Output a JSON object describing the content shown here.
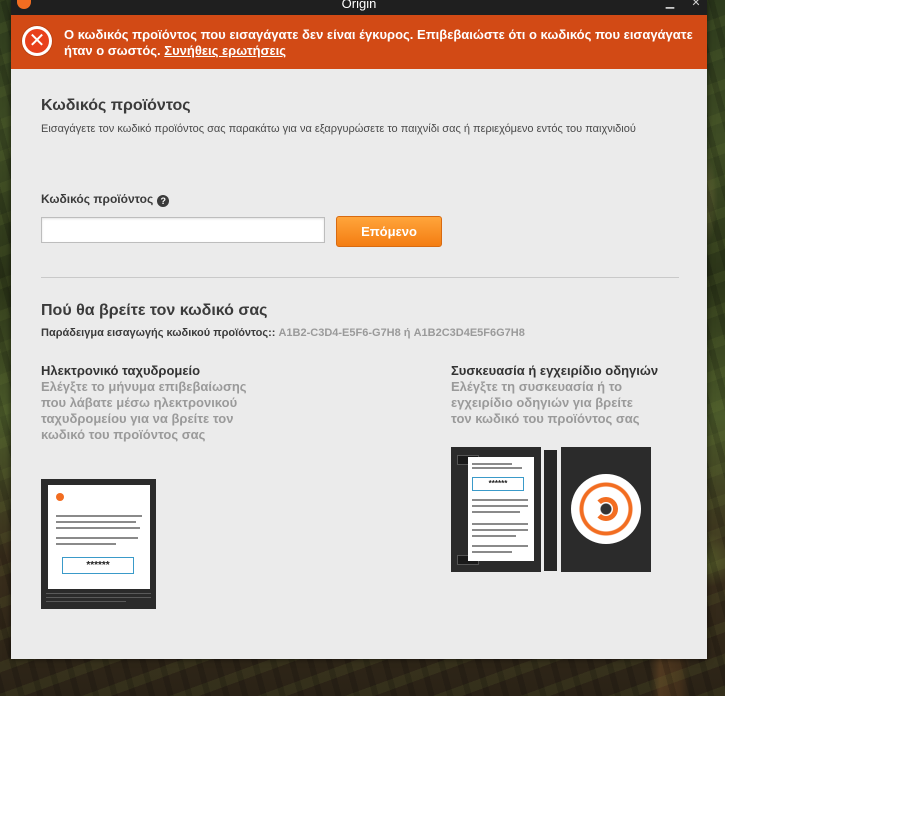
{
  "window": {
    "title": "Origin"
  },
  "error": {
    "message": "Ο κωδικός προϊόντος που εισαγάγατε δεν είναι έγκυρος. Επιβεβαιώστε ότι ο κωδικός που εισαγάγατε ήταν ο σωστός.",
    "faq_link": "Συνήθεις ερωτήσεις"
  },
  "product_code": {
    "heading": "Κωδικός προϊόντος",
    "description": "Εισαγάγετε τον κωδικό προϊόντος σας παρακάτω για να εξαργυρώσετε το παιχνίδι σας ή περιεχόμενο εντός του παιχνιδιού",
    "field_label": "Κωδικός προϊόντος",
    "input_value": "",
    "next_label": "Επόμενο"
  },
  "where": {
    "heading": "Πού θα βρείτε τον κωδικό σας",
    "example_label": "Παράδειγμα εισαγωγής κωδικού προϊόντος::",
    "example_codes": "A1B2-C3D4-E5F6-G7H8 ή A1B2C3D4E5F6G7H8",
    "email": {
      "title": "Ηλεκτρονικό ταχυδρομείο",
      "description": "Ελέγξτε το μήνυμα επιβεβαίωσης που λάβατε μέσω ηλεκτρονικού ταχυδρομείου για να βρείτε τον κωδικό του προϊόντος σας",
      "illustration_code": "******"
    },
    "package": {
      "title": "Συσκευασία ή εγχειρίδιο οδηγιών",
      "description": "Ελέγξτε τη συσκευασία ή το εγχειρίδιο οδηγιών για βρείτε τον κωδικό του προϊόντος σας",
      "illustration_code": "******"
    }
  },
  "colors": {
    "error_banner": "#d24a15",
    "accent_orange": "#f47d12",
    "window_bg": "#ebebeb"
  }
}
